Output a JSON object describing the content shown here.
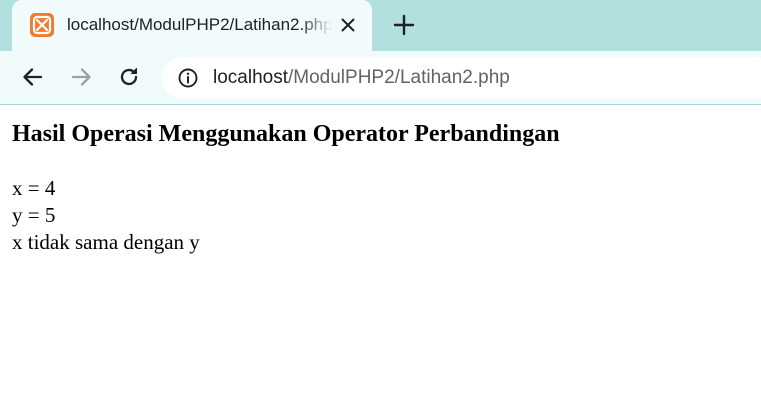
{
  "browser": {
    "tab": {
      "favicon": "xampp-favicon-icon",
      "title": "localhost/ModulPHP2/Latihan2.php"
    },
    "address": {
      "host": "localhost",
      "path": "/ModulPHP2/Latihan2.php"
    },
    "icons": [
      "close-icon",
      "plus-icon",
      "arrow-left-icon",
      "arrow-right-icon",
      "reload-icon",
      "info-icon"
    ]
  },
  "colors": {
    "tabstrip": "#b2e0df",
    "toolbar": "#f2fbfb",
    "favicon": "#f27c2d"
  },
  "page": {
    "heading": "Hasil Operasi Menggunakan Operator Perbandingan",
    "lines": [
      "x = 4",
      "y = 5",
      "x tidak sama dengan y"
    ]
  }
}
